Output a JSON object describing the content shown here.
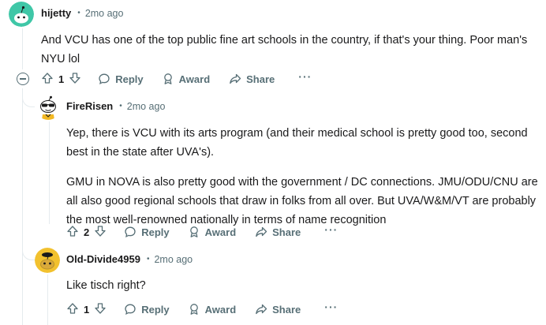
{
  "comments": [
    {
      "author": "hijetty",
      "time": "2mo ago",
      "paragraphs": [
        "And VCU has one of the top public fine art schools in the country, if that's your thing. Poor man's NYU lol"
      ],
      "score": "1",
      "avatar_icon": "snoo-teal-icon"
    },
    {
      "author": "FireRisen",
      "time": "2mo ago",
      "paragraphs": [
        "Yep, there is VCU with its arts program (and their medical school is pretty good too, second best in the state after UVA's).",
        "GMU in NOVA is also pretty good with the government / DC connections. JMU/ODU/CNU are all also good regional schools that draw in folks from all over. But UVA/W&M/VT are probably the most well-renowned nationally in terms of name recognition"
      ],
      "score": "2",
      "avatar_icon": "snoo-sunglasses-icon"
    },
    {
      "author": "Old-Divide4959",
      "time": "2mo ago",
      "paragraphs": [
        "Like tisch right?"
      ],
      "score": "1",
      "avatar_icon": "snoo-yellow-icon"
    }
  ],
  "actions": {
    "reply": "Reply",
    "award": "Award",
    "share": "Share",
    "more": "···"
  },
  "dot": "•",
  "colors": {
    "meta": "#576f76",
    "thread": "#e5ebee",
    "teal_avatar": "#3fc7a7",
    "yellow_avatar": "#f2c12e"
  }
}
